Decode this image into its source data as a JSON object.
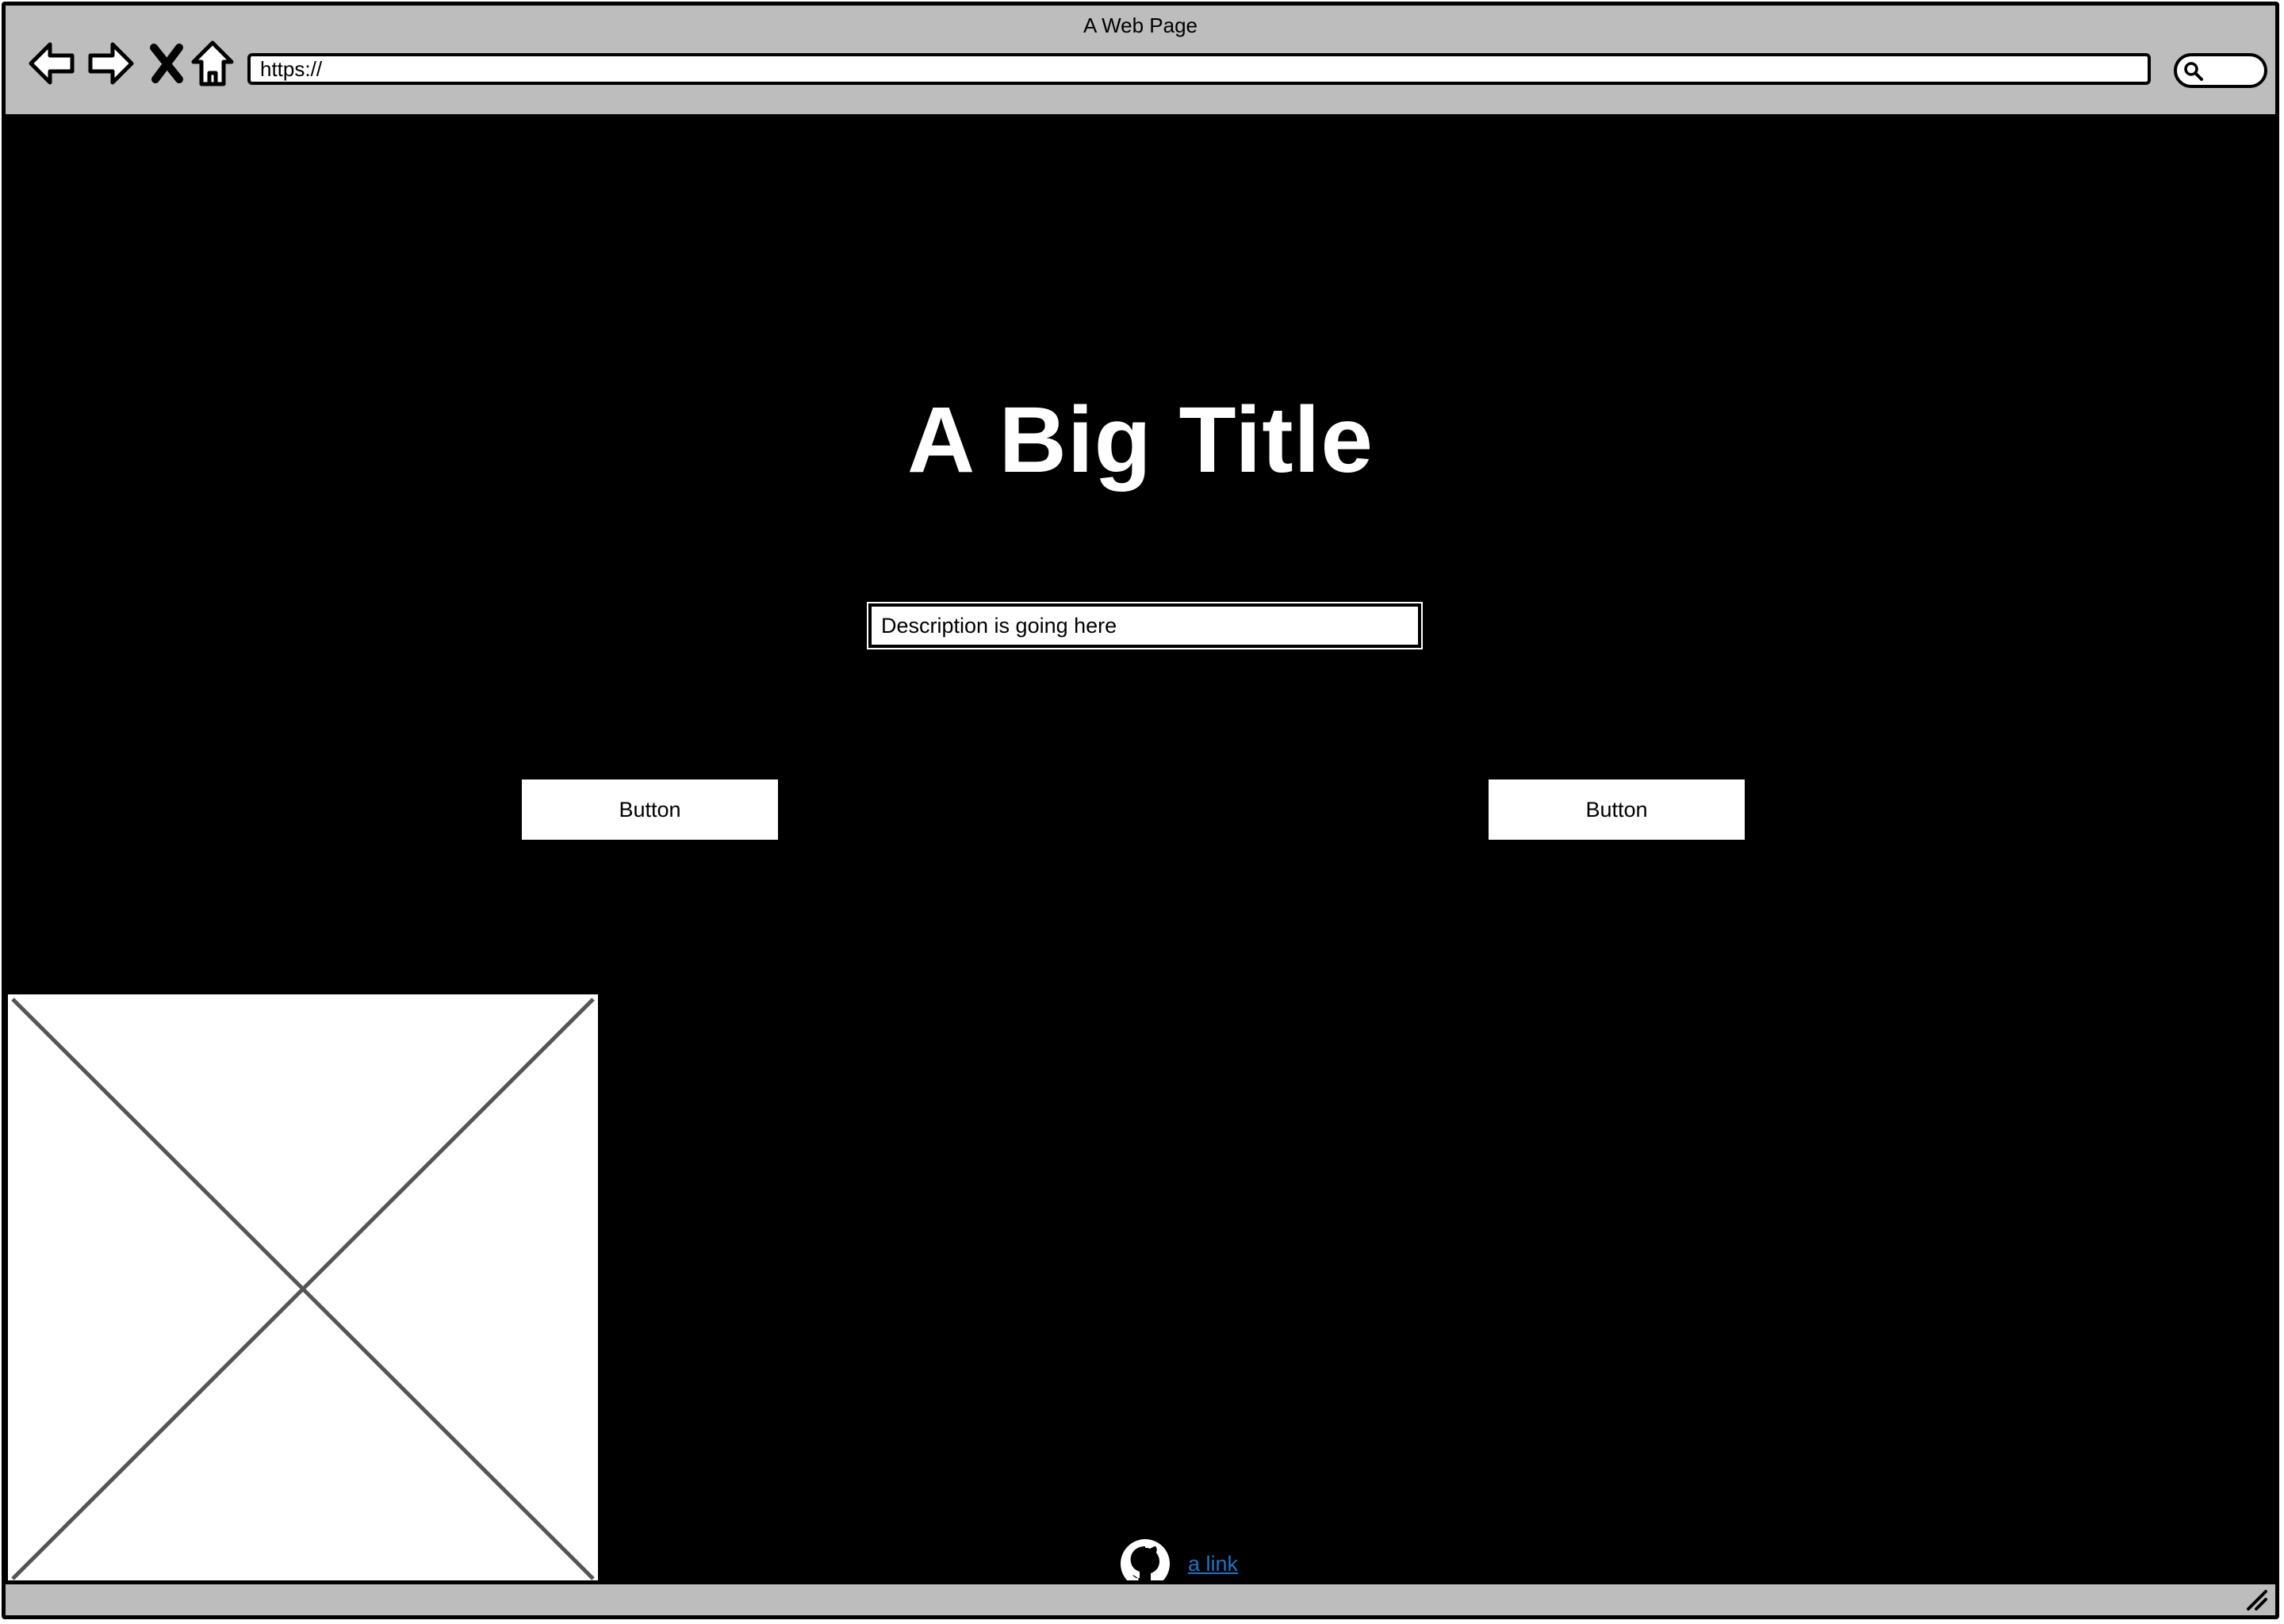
{
  "window": {
    "title": "A Web Page"
  },
  "toolbar": {
    "back_icon": "back-arrow-icon",
    "forward_icon": "forward-arrow-icon",
    "stop_icon": "close-icon",
    "home_icon": "home-icon",
    "url": "https://",
    "search_icon": "search-icon"
  },
  "main": {
    "title": "A Big Title",
    "description": "Description is going here",
    "buttons": [
      {
        "label": "Button"
      },
      {
        "label": "Button"
      }
    ],
    "image_placeholder_icon": "image-placeholder-icon"
  },
  "footer": {
    "icon": "github-icon",
    "link_text": "a link",
    "link_color": "#1e73c8"
  },
  "colors": {
    "page_background": "#000000",
    "chrome_background": "#bdbdbd",
    "text_on_dark": "#ffffff"
  }
}
